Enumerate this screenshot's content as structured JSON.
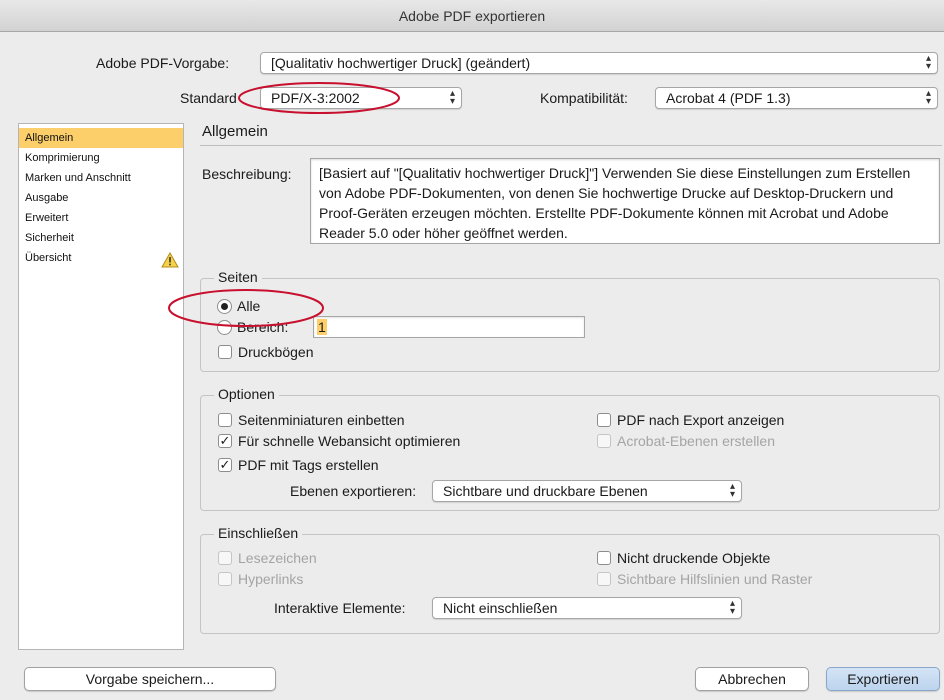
{
  "window": {
    "title": "Adobe PDF exportieren"
  },
  "header": {
    "preset_label": "Adobe PDF-Vorgabe:",
    "preset_value": "[Qualitativ hochwertiger Druck] (geändert)",
    "standard_label": "Standard",
    "standard_value": "PDF/X-3:2002",
    "compat_label": "Kompatibilität:",
    "compat_value": "Acrobat 4 (PDF 1.3)"
  },
  "sidebar": {
    "items": [
      {
        "label": "Allgemein",
        "active": true
      },
      {
        "label": "Komprimierung"
      },
      {
        "label": "Marken und Anschnitt"
      },
      {
        "label": "Ausgabe"
      },
      {
        "label": "Erweitert"
      },
      {
        "label": "Sicherheit"
      },
      {
        "label": "Übersicht",
        "icon": "warning-icon"
      }
    ]
  },
  "main": {
    "section_title": "Allgemein",
    "description_label": "Beschreibung:",
    "description_text": "[Basiert auf \"[Qualitativ hochwertiger Druck]\"] Verwenden Sie diese Einstellungen zum Erstellen von Adobe PDF-Dokumenten, von denen Sie hochwertige Drucke auf Desktop-Druckern und Proof-Geräten erzeugen möchten. Erstellte PDF-Dokumente können mit Acrobat und Adobe Reader 5.0 oder höher geöffnet werden."
  },
  "pages": {
    "title": "Seiten",
    "all_label": "Alle",
    "range_label": "Bereich:",
    "range_value": "1",
    "spreads_label": "Druckbögen"
  },
  "options": {
    "title": "Optionen",
    "thumbnails_label": "Seitenminiaturen einbetten",
    "fastweb_label": "Für schnelle Webansicht optimieren",
    "tagged_label": "PDF mit Tags erstellen",
    "view_after_label": "PDF nach Export anzeigen",
    "acrobat_layers_label": "Acrobat-Ebenen erstellen",
    "export_layers_label": "Ebenen exportieren:",
    "export_layers_value": "Sichtbare und druckbare Ebenen"
  },
  "include": {
    "title": "Einschließen",
    "bookmarks_label": "Lesezeichen",
    "hyperlinks_label": "Hyperlinks",
    "nonprinting_label": "Nicht druckende Objekte",
    "guides_label": "Sichtbare Hilfslinien und Raster",
    "interactive_label": "Interaktive Elemente:",
    "interactive_value": "Nicht einschließen"
  },
  "footer": {
    "save_preset_label": "Vorgabe speichern...",
    "cancel_label": "Abbrechen",
    "export_label": "Exportieren"
  },
  "colors": {
    "sidebar_active": "#fccf6b",
    "annotation": "#c8102e",
    "default_button": "#bcd4ee"
  }
}
